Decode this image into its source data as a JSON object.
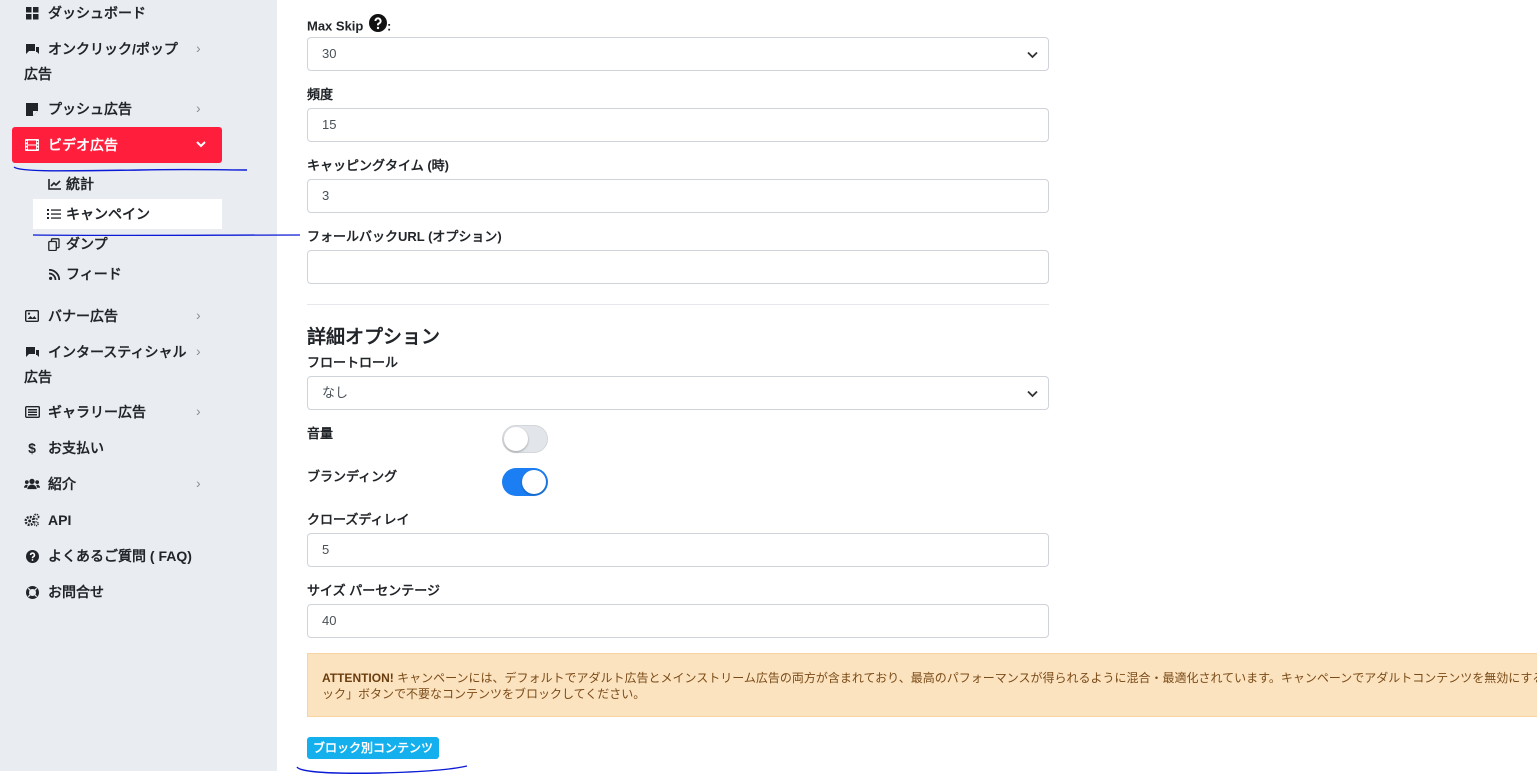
{
  "sidebar": {
    "items": [
      {
        "label": "ダッシュボード",
        "icon": "dashboard-icon"
      },
      {
        "label": "オンクリック/ポップ",
        "label2": "広告",
        "icon": "popup-icon"
      },
      {
        "label": "プッシュ広告",
        "icon": "push-icon"
      },
      {
        "label": "ビデオ広告",
        "icon": "film-icon"
      },
      {
        "label": "バナー広告",
        "icon": "image-icon"
      },
      {
        "label": "インタースティシャル",
        "label2": "広告",
        "icon": "interstitial-icon"
      },
      {
        "label": "ギャラリー広告",
        "icon": "gallery-icon"
      },
      {
        "label": "お支払い",
        "icon": "dollar-icon"
      },
      {
        "label": "紹介",
        "icon": "users-icon"
      },
      {
        "label": "API",
        "icon": "cogs-icon"
      },
      {
        "label": "よくあるご質問 ( FAQ)",
        "icon": "question-icon"
      },
      {
        "label": "お問合せ",
        "icon": "lifebuoy-icon"
      }
    ],
    "sub_items": [
      {
        "label": "統計",
        "icon": "chart-line-icon"
      },
      {
        "label": "キャンペイン",
        "icon": "list-icon"
      },
      {
        "label": "ダンプ",
        "icon": "copy-icon"
      },
      {
        "label": "フィード",
        "icon": "rss-icon"
      }
    ],
    "accent_color": "#ff1f3d"
  },
  "form": {
    "max_skip_label": "Max Skip",
    "max_skip_colon": ":",
    "max_skip_value": "30",
    "frequency_label": "頻度",
    "frequency_value": "15",
    "capping_label": "キャッピングタイム (時)",
    "capping_value": "3",
    "fallback_label": "フォールバックURL (オプション)",
    "fallback_value": "",
    "advanced_title": "詳細オプション",
    "frontroll_label": "フロートロール",
    "frontroll_value": "なし",
    "volume_label": "音量",
    "volume_on": false,
    "branding_label": "ブランディング",
    "branding_on": true,
    "close_delay_label": "クローズディレイ",
    "close_delay_value": "5",
    "size_label": "サイズ パーセンテージ",
    "size_value": "40",
    "toggle_on_color": "#1b7ef2"
  },
  "alert": {
    "strong": "ATTENTION!",
    "line1": " キャンペーンには、デフォルトでアダルト広告とメインストリーム広告の両方が含まれており、最高のパフォーマンスが得られるように混合・最適化されています。キャンペーンでアダルトコンテンツを無効にする",
    "line2": "ック」ボタンで不要なコンテンツをブロックしてください。"
  },
  "block_button_label": "ブロック別コンテンツ",
  "annotation_color": "#0a1ad6"
}
